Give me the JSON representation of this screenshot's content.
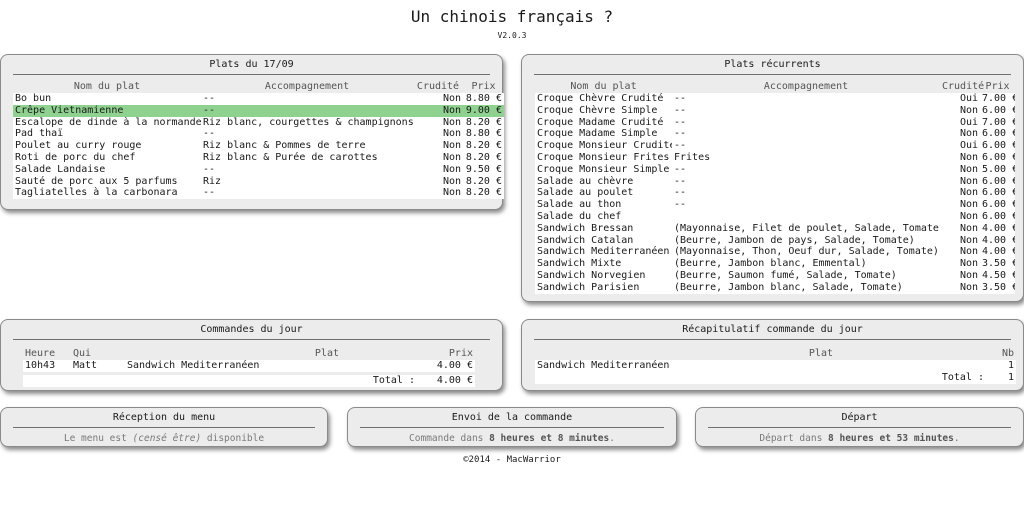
{
  "app": {
    "title": "Un chinois français ?",
    "version": "V2.0.3",
    "footer": "©2014 - MacWarrior"
  },
  "plats_jour": {
    "title": "Plats du 17/09",
    "headers": {
      "nom": "Nom du plat",
      "accomp": "Accompagnement",
      "crudite": "Crudité",
      "prix": "Prix"
    },
    "rows": [
      {
        "nom": "Bo bun",
        "accomp": "--",
        "crudite": "Non",
        "prix": "8.80 €"
      },
      {
        "nom": "Crêpe Vietnamienne",
        "accomp": "--",
        "crudite": "Non",
        "prix": "9.00 €",
        "selected": true
      },
      {
        "nom": "Escalope de dinde à la normande",
        "accomp": "Riz blanc, courgettes & champignons",
        "crudite": "Non",
        "prix": "8.20 €"
      },
      {
        "nom": "Pad thaï",
        "accomp": "--",
        "crudite": "Non",
        "prix": "8.80 €"
      },
      {
        "nom": "Poulet au curry rouge",
        "accomp": "Riz blanc & Pommes de terre",
        "crudite": "Non",
        "prix": "8.20 €"
      },
      {
        "nom": "Roti de porc du chef",
        "accomp": "Riz blanc & Purée de carottes",
        "crudite": "Non",
        "prix": "8.20 €"
      },
      {
        "nom": "Salade Landaise",
        "accomp": "--",
        "crudite": "Non",
        "prix": "9.50 €"
      },
      {
        "nom": "Sauté de porc aux 5 parfums",
        "accomp": "Riz",
        "crudite": "Non",
        "prix": "8.20 €"
      },
      {
        "nom": "Tagliatelles à la carbonara",
        "accomp": "--",
        "crudite": "Non",
        "prix": "8.20 €"
      }
    ]
  },
  "plats_recurrents": {
    "title": "Plats récurrents",
    "headers": {
      "nom": "Nom du plat",
      "accomp": "Accompagnement",
      "crudite": "Crudité",
      "prix": "Prix"
    },
    "rows": [
      {
        "nom": "Croque Chèvre Crudité",
        "accomp": "--",
        "crudite": "Oui",
        "prix": "7.00 €"
      },
      {
        "nom": "Croque Chèvre Simple",
        "accomp": "--",
        "crudite": "Non",
        "prix": "6.00 €"
      },
      {
        "nom": "Croque Madame Crudité",
        "accomp": "--",
        "crudite": "Oui",
        "prix": "7.00 €"
      },
      {
        "nom": "Croque Madame Simple",
        "accomp": "--",
        "crudite": "Non",
        "prix": "6.00 €"
      },
      {
        "nom": "Croque Monsieur Crudité",
        "accomp": "--",
        "crudite": "Oui",
        "prix": "6.00 €"
      },
      {
        "nom": "Croque Monsieur Frites",
        "accomp": "Frites",
        "crudite": "Non",
        "prix": "6.00 €"
      },
      {
        "nom": "Croque Monsieur Simple",
        "accomp": "--",
        "crudite": "Non",
        "prix": "5.00 €"
      },
      {
        "nom": "Salade au chèvre",
        "accomp": "--",
        "crudite": "Non",
        "prix": "6.00 €"
      },
      {
        "nom": "Salade au poulet",
        "accomp": "--",
        "crudite": "Non",
        "prix": "6.00 €"
      },
      {
        "nom": "Salade au thon",
        "accomp": "--",
        "crudite": "Non",
        "prix": "6.00 €"
      },
      {
        "nom": "Salade du chef",
        "accomp": "",
        "crudite": "Non",
        "prix": "6.00 €"
      },
      {
        "nom": "Sandwich Bressan",
        "accomp": "(Mayonnaise, Filet de poulet, Salade, Tomate)",
        "crudite": "Non",
        "prix": "4.00 €"
      },
      {
        "nom": "Sandwich Catalan",
        "accomp": "(Beurre, Jambon de pays, Salade, Tomate)",
        "crudite": "Non",
        "prix": "4.00 €"
      },
      {
        "nom": "Sandwich Mediterranéen",
        "accomp": "(Mayonnaise, Thon, Oeuf dur, Salade, Tomate)",
        "crudite": "Non",
        "prix": "4.00 €"
      },
      {
        "nom": "Sandwich Mixte",
        "accomp": "(Beurre, Jambon blanc, Emmental)",
        "crudite": "Non",
        "prix": "3.50 €"
      },
      {
        "nom": "Sandwich Norvegien",
        "accomp": "(Beurre, Saumon fumé, Salade, Tomate)",
        "crudite": "Non",
        "prix": "4.50 €"
      },
      {
        "nom": "Sandwich Parisien",
        "accomp": "(Beurre, Jambon blanc, Salade, Tomate)",
        "crudite": "Non",
        "prix": "3.50 €"
      }
    ]
  },
  "commandes": {
    "title": "Commandes du jour",
    "headers": {
      "heure": "Heure",
      "qui": "Qui",
      "plat": "Plat",
      "prix": "Prix"
    },
    "rows": [
      {
        "heure": "10h43",
        "qui": "Matt",
        "plat": "Sandwich Mediterranéen",
        "prix": "4.00 €"
      }
    ],
    "total_label": "Total :",
    "total": "4.00 €"
  },
  "recap": {
    "title": "Récapitulatif commande du jour",
    "headers": {
      "plat": "Plat",
      "nb": "Nb"
    },
    "rows": [
      {
        "plat": "Sandwich Mediterranéen",
        "nb": "1"
      }
    ],
    "total_label": "Total :",
    "total": "1"
  },
  "reception": {
    "title": "Réception du menu",
    "text_before": "Le menu est ",
    "text_italic": "(censé être)",
    "text_after": " disponible"
  },
  "envoi": {
    "title": "Envoi de la commande",
    "text_before": "Commande dans ",
    "bold": "8 heures et 8 minutes",
    "text_after": "."
  },
  "depart": {
    "title": "Départ",
    "text_before": "Départ dans ",
    "bold": "8 heures et 53 minutes",
    "text_after": "."
  }
}
